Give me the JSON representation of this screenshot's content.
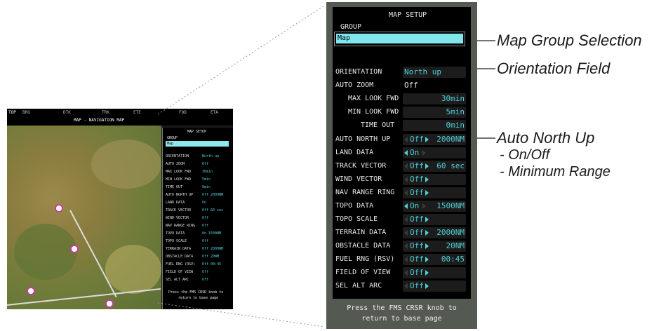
{
  "thumbnail": {
    "status_bar": {
      "top_left": "TOP",
      "bearing": "BRG",
      "track": "TRK",
      "dtk": "DTK",
      "ete": "ETE",
      "title": "MAP - NAVIGATION MAP",
      "fob": "FOD",
      "eta": "ETA"
    },
    "panel_title": "MAP SETUP",
    "group_label": "GROUP",
    "group_value": "Map",
    "rows": [
      {
        "label": "ORIENTATION",
        "value": "North up"
      },
      {
        "label": "AUTO ZOOM",
        "value": "Off"
      },
      {
        "label": "MAX LOOK FWD",
        "value": "30min"
      },
      {
        "label": "MIN LOOK FWD",
        "value": "5min"
      },
      {
        "label": "TIME OUT",
        "value": "0min"
      },
      {
        "label": "AUTO NORTH UP",
        "value": "Off  2000NM"
      },
      {
        "label": "LAND DATA",
        "value": "On"
      },
      {
        "label": "TRACK VECTOR",
        "value": "Off  60 sec"
      },
      {
        "label": "WIND VECTOR",
        "value": "Off"
      },
      {
        "label": "NAV RANGE RING",
        "value": "Off"
      },
      {
        "label": "TOPO DATA",
        "value": "On  1500NM"
      },
      {
        "label": "TOPO SCALE",
        "value": "Off"
      },
      {
        "label": "TERRAIN DATA",
        "value": "Off  2000NM"
      },
      {
        "label": "OBSTACLE DATA",
        "value": "Off  20NM"
      },
      {
        "label": "FUEL RNG (RSV)",
        "value": "Off  00:45"
      },
      {
        "label": "FIELD OF VIEW",
        "value": "Off"
      },
      {
        "label": "SEL ALT ARC",
        "value": "Off"
      }
    ],
    "footer": [
      "Press the FMS CRSR knob to",
      "return to base page"
    ]
  },
  "panel": {
    "title": "MAP SETUP",
    "group_label": "GROUP",
    "group_value": "Map",
    "rows": {
      "orientation": {
        "label": "ORIENTATION",
        "value": "North up"
      },
      "auto_zoom": {
        "label": "AUTO ZOOM",
        "value": "Off"
      },
      "max_look_fwd": {
        "label": "MAX LOOK FWD",
        "value": "30min"
      },
      "min_look_fwd": {
        "label": "MIN LOOK FWD",
        "value": "5min"
      },
      "time_out": {
        "label": "TIME OUT",
        "value": "0min"
      },
      "auto_north_up": {
        "label": "AUTO NORTH UP",
        "toggle": "Off",
        "range": "2000NM"
      },
      "land_data": {
        "label": "LAND DATA",
        "toggle": "On"
      },
      "track_vector": {
        "label": "TRACK VECTOR",
        "toggle": "Off",
        "range": "60 sec"
      },
      "wind_vector": {
        "label": "WIND VECTOR",
        "toggle": "Off"
      },
      "nav_range_ring": {
        "label": "NAV RANGE RING",
        "toggle": "Off"
      },
      "topo_data": {
        "label": "TOPO DATA",
        "toggle": "On",
        "range": "1500NM"
      },
      "topo_scale": {
        "label": "TOPO SCALE",
        "toggle": "Off"
      },
      "terrain_data": {
        "label": "TERRAIN DATA",
        "toggle": "Off",
        "range": "2000NM"
      },
      "obstacle_data": {
        "label": "OBSTACLE DATA",
        "toggle": "Off",
        "range": "20NM"
      },
      "fuel_rng": {
        "label": "FUEL RNG (RSV)",
        "toggle": "Off",
        "range": "00:45"
      },
      "field_of_view": {
        "label": "FIELD OF VIEW",
        "toggle": "Off"
      },
      "sel_alt_arc": {
        "label": "SEL ALT ARC",
        "toggle": "Off"
      }
    },
    "footer_line1": "Press the FMS CRSR knob to",
    "footer_line2": "return to base page"
  },
  "callouts": {
    "map_group": "Map Group Selection",
    "orientation": "Orientation Field",
    "auto_north_up": "Auto North Up",
    "on_off": "- On/Off",
    "minimum_range": "- Minimum Range"
  },
  "colors": {
    "cyan_value": "#4fd0d8",
    "panel_border": "#545a52",
    "label_text": "#e8e8e8"
  }
}
